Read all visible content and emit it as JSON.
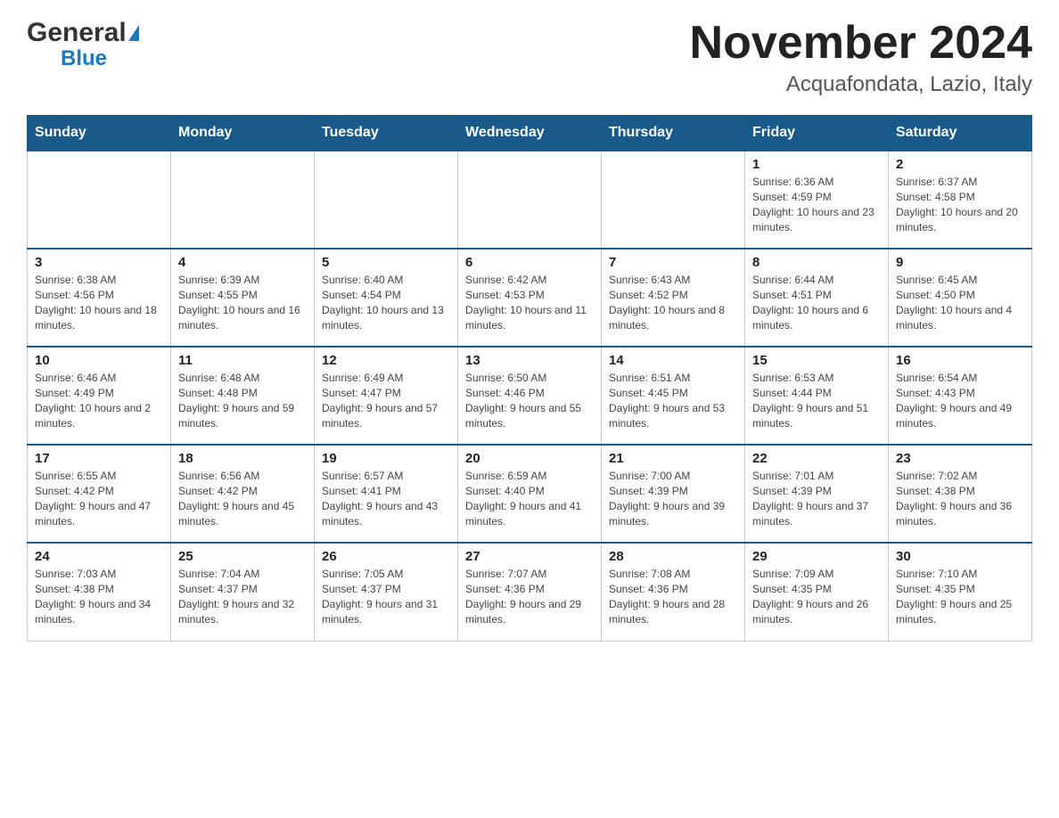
{
  "header": {
    "logo_general": "General",
    "logo_triangle": "▲",
    "logo_blue": "Blue",
    "title": "November 2024",
    "subtitle": "Acquafondata, Lazio, Italy"
  },
  "days_of_week": [
    "Sunday",
    "Monday",
    "Tuesday",
    "Wednesday",
    "Thursday",
    "Friday",
    "Saturday"
  ],
  "weeks": [
    {
      "days": [
        {
          "day": "",
          "info": ""
        },
        {
          "day": "",
          "info": ""
        },
        {
          "day": "",
          "info": ""
        },
        {
          "day": "",
          "info": ""
        },
        {
          "day": "",
          "info": ""
        },
        {
          "day": "1",
          "info": "Sunrise: 6:36 AM\nSunset: 4:59 PM\nDaylight: 10 hours and 23 minutes."
        },
        {
          "day": "2",
          "info": "Sunrise: 6:37 AM\nSunset: 4:58 PM\nDaylight: 10 hours and 20 minutes."
        }
      ]
    },
    {
      "days": [
        {
          "day": "3",
          "info": "Sunrise: 6:38 AM\nSunset: 4:56 PM\nDaylight: 10 hours and 18 minutes."
        },
        {
          "day": "4",
          "info": "Sunrise: 6:39 AM\nSunset: 4:55 PM\nDaylight: 10 hours and 16 minutes."
        },
        {
          "day": "5",
          "info": "Sunrise: 6:40 AM\nSunset: 4:54 PM\nDaylight: 10 hours and 13 minutes."
        },
        {
          "day": "6",
          "info": "Sunrise: 6:42 AM\nSunset: 4:53 PM\nDaylight: 10 hours and 11 minutes."
        },
        {
          "day": "7",
          "info": "Sunrise: 6:43 AM\nSunset: 4:52 PM\nDaylight: 10 hours and 8 minutes."
        },
        {
          "day": "8",
          "info": "Sunrise: 6:44 AM\nSunset: 4:51 PM\nDaylight: 10 hours and 6 minutes."
        },
        {
          "day": "9",
          "info": "Sunrise: 6:45 AM\nSunset: 4:50 PM\nDaylight: 10 hours and 4 minutes."
        }
      ]
    },
    {
      "days": [
        {
          "day": "10",
          "info": "Sunrise: 6:46 AM\nSunset: 4:49 PM\nDaylight: 10 hours and 2 minutes."
        },
        {
          "day": "11",
          "info": "Sunrise: 6:48 AM\nSunset: 4:48 PM\nDaylight: 9 hours and 59 minutes."
        },
        {
          "day": "12",
          "info": "Sunrise: 6:49 AM\nSunset: 4:47 PM\nDaylight: 9 hours and 57 minutes."
        },
        {
          "day": "13",
          "info": "Sunrise: 6:50 AM\nSunset: 4:46 PM\nDaylight: 9 hours and 55 minutes."
        },
        {
          "day": "14",
          "info": "Sunrise: 6:51 AM\nSunset: 4:45 PM\nDaylight: 9 hours and 53 minutes."
        },
        {
          "day": "15",
          "info": "Sunrise: 6:53 AM\nSunset: 4:44 PM\nDaylight: 9 hours and 51 minutes."
        },
        {
          "day": "16",
          "info": "Sunrise: 6:54 AM\nSunset: 4:43 PM\nDaylight: 9 hours and 49 minutes."
        }
      ]
    },
    {
      "days": [
        {
          "day": "17",
          "info": "Sunrise: 6:55 AM\nSunset: 4:42 PM\nDaylight: 9 hours and 47 minutes."
        },
        {
          "day": "18",
          "info": "Sunrise: 6:56 AM\nSunset: 4:42 PM\nDaylight: 9 hours and 45 minutes."
        },
        {
          "day": "19",
          "info": "Sunrise: 6:57 AM\nSunset: 4:41 PM\nDaylight: 9 hours and 43 minutes."
        },
        {
          "day": "20",
          "info": "Sunrise: 6:59 AM\nSunset: 4:40 PM\nDaylight: 9 hours and 41 minutes."
        },
        {
          "day": "21",
          "info": "Sunrise: 7:00 AM\nSunset: 4:39 PM\nDaylight: 9 hours and 39 minutes."
        },
        {
          "day": "22",
          "info": "Sunrise: 7:01 AM\nSunset: 4:39 PM\nDaylight: 9 hours and 37 minutes."
        },
        {
          "day": "23",
          "info": "Sunrise: 7:02 AM\nSunset: 4:38 PM\nDaylight: 9 hours and 36 minutes."
        }
      ]
    },
    {
      "days": [
        {
          "day": "24",
          "info": "Sunrise: 7:03 AM\nSunset: 4:38 PM\nDaylight: 9 hours and 34 minutes."
        },
        {
          "day": "25",
          "info": "Sunrise: 7:04 AM\nSunset: 4:37 PM\nDaylight: 9 hours and 32 minutes."
        },
        {
          "day": "26",
          "info": "Sunrise: 7:05 AM\nSunset: 4:37 PM\nDaylight: 9 hours and 31 minutes."
        },
        {
          "day": "27",
          "info": "Sunrise: 7:07 AM\nSunset: 4:36 PM\nDaylight: 9 hours and 29 minutes."
        },
        {
          "day": "28",
          "info": "Sunrise: 7:08 AM\nSunset: 4:36 PM\nDaylight: 9 hours and 28 minutes."
        },
        {
          "day": "29",
          "info": "Sunrise: 7:09 AM\nSunset: 4:35 PM\nDaylight: 9 hours and 26 minutes."
        },
        {
          "day": "30",
          "info": "Sunrise: 7:10 AM\nSunset: 4:35 PM\nDaylight: 9 hours and 25 minutes."
        }
      ]
    }
  ]
}
